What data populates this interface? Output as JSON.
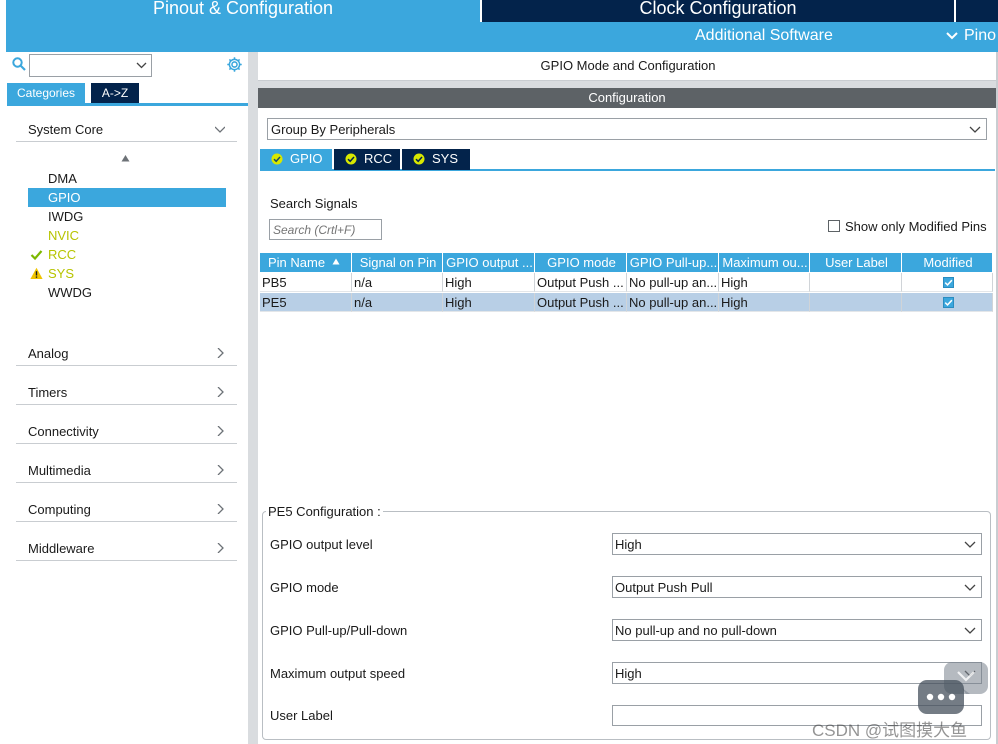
{
  "top_tabs": {
    "pinout": "Pinout & Configuration",
    "clock": "Clock Configuration",
    "additional": "Additional Software",
    "pinout_view": "Pino"
  },
  "left": {
    "search_value": "",
    "tabs": {
      "categories": "Categories",
      "atoz": "A->Z"
    },
    "system_core": {
      "label": "System Core",
      "items": [
        {
          "label": "DMA",
          "state": "none"
        },
        {
          "label": "GPIO",
          "state": "selected"
        },
        {
          "label": "IWDG",
          "state": "none"
        },
        {
          "label": "NVIC",
          "state": "configured"
        },
        {
          "label": "RCC",
          "state": "ok"
        },
        {
          "label": "SYS",
          "state": "warning"
        },
        {
          "label": "WWDG",
          "state": "none"
        }
      ]
    },
    "sections": [
      "Analog",
      "Timers",
      "Connectivity",
      "Multimedia",
      "Computing",
      "Middleware"
    ]
  },
  "right": {
    "mode_title": "GPIO Mode and Configuration",
    "config_header": "Configuration",
    "group_by": "Group By Peripherals",
    "peripheral_tabs": [
      "GPIO",
      "RCC",
      "SYS"
    ],
    "search_signals_label": "Search Signals",
    "search_placeholder": "Search (Crtl+F)",
    "show_modified_label": "Show only Modified Pins",
    "table": {
      "columns": [
        "Pin Name",
        "Signal on Pin",
        "GPIO output ...",
        "GPIO mode",
        "GPIO Pull-up...",
        "Maximum ou...",
        "User Label",
        "Modified"
      ],
      "rows": [
        {
          "pin": "PB5",
          "signal": "n/a",
          "output_level": "High",
          "mode": "Output Push ...",
          "pull": "No pull-up an...",
          "speed": "High",
          "user_label": "",
          "modified": true,
          "selected": false
        },
        {
          "pin": "PE5",
          "signal": "n/a",
          "output_level": "High",
          "mode": "Output Push ...",
          "pull": "No pull-up an...",
          "speed": "High",
          "user_label": "",
          "modified": true,
          "selected": true
        }
      ]
    },
    "pe5_config": {
      "title": "PE5 Configuration :",
      "fields": [
        {
          "label": "GPIO output level",
          "value": "High"
        },
        {
          "label": "GPIO mode",
          "value": "Output Push Pull"
        },
        {
          "label": "GPIO Pull-up/Pull-down",
          "value": "No pull-up and no pull-down"
        },
        {
          "label": "Maximum output speed",
          "value": "High"
        },
        {
          "label": "User Label",
          "value": ""
        }
      ]
    }
  },
  "watermark": "CSDN @试图摸大鱼",
  "colors": {
    "accent_blue": "#3ba7dd",
    "dark_navy": "#03234b",
    "header_gray": "#5d6266",
    "selected_row": "#b8cfe6",
    "configured_yellow": "#b7c400",
    "ok_green": "#7cb800"
  },
  "icons": {
    "search": "search-icon",
    "gear": "gear-icon",
    "check_circle": "check-circle-icon",
    "warning": "warning-icon",
    "checkmark": "checkmark-icon",
    "chevron_down": "chevron-down-icon",
    "chevron_right": "chevron-right-icon",
    "sort": "sort-ascending-icon"
  }
}
